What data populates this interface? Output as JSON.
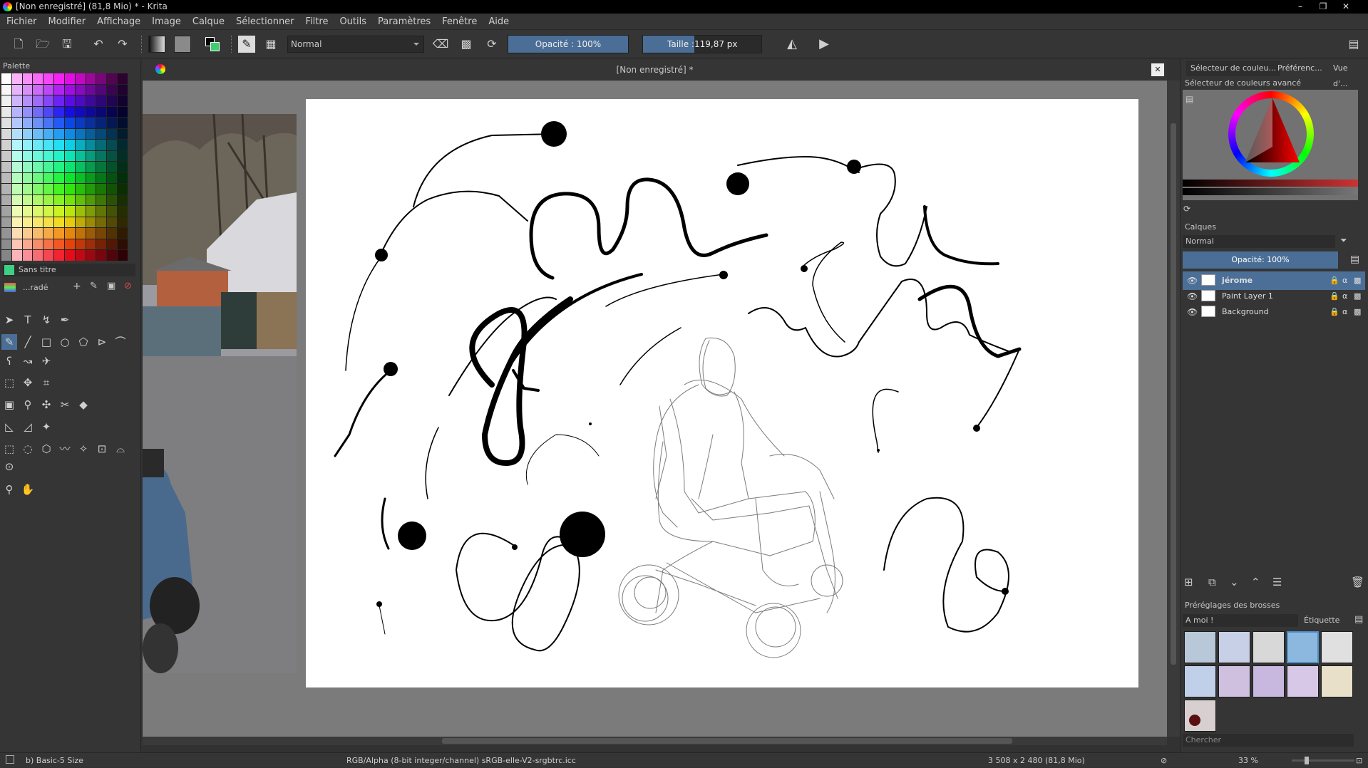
{
  "titlebar": {
    "title": "[Non enregistré]  (81,8 Mio)  * - Krita",
    "min": "–",
    "restore": "❐",
    "close": "✕"
  },
  "menu": [
    "Fichier",
    "Modifier",
    "Affichage",
    "Image",
    "Calque",
    "Sélectionner",
    "Filtre",
    "Outils",
    "Paramètres",
    "Fenêtre",
    "Aide"
  ],
  "toolbar": {
    "blend_mode": "Normal",
    "opacity_label": "Opacité : 100%",
    "opacity_value": 1.0,
    "size_label": "Taille :",
    "size_value": "119,87 px"
  },
  "left": {
    "palette_title": "Palette",
    "palette_name": "Sans titre",
    "gradient_label": "...radé"
  },
  "document": {
    "tab_title": "[Non enregistré]  *",
    "close": "✕"
  },
  "right": {
    "tabs": [
      "Sélecteur de couleu...",
      "Préférenc...",
      "Vue d'..."
    ],
    "color_selector_title": "Sélecteur de couleurs avancé",
    "layers_title": "Calques",
    "layer_blend": "Normal",
    "layer_opacity": "Opacité:  100%",
    "layers": [
      {
        "name": "jérome",
        "selected": true
      },
      {
        "name": "Paint Layer 1",
        "selected": false
      },
      {
        "name": "Background",
        "selected": false
      }
    ],
    "brush_presets_title": "Préréglages des brosses",
    "brush_tag": "A moi !",
    "brush_tag_label": "Étiquette",
    "search_placeholder": "Chercher"
  },
  "status": {
    "brush": "b) Basic-5 Size",
    "color_space": "RGB/Alpha (8-bit integer/channel)  sRGB-elle-V2-srgbtrc.icc",
    "dimensions": "3 508 x 2 480 (81,8 Mio)",
    "zoom": "33 %"
  },
  "colors": {
    "accent": "#4b6e96",
    "selection": "#4c6f98",
    "bg": "#353535"
  }
}
